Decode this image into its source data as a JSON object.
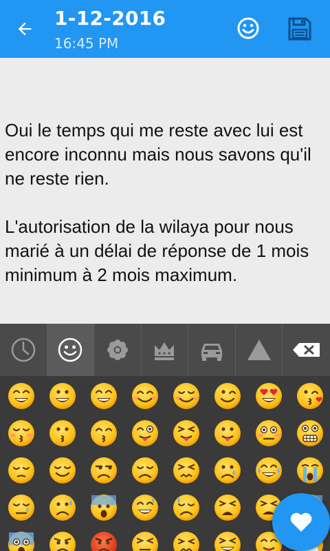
{
  "header": {
    "title": "1-12-2016",
    "subtitle": "16:45 PM",
    "back_icon": "arrow-back-icon",
    "emoji_icon": "smiley-icon",
    "save_icon": "floppy-disk-icon",
    "color": "#2196f3"
  },
  "note": {
    "paragraphs": [
      "Oui le temps qui me reste avec lui est encore inconnu mais nous savons qu'il ne reste rien.",
      "L'autorisation de la wilaya pour nous marié à un délai de réponse de 1 mois minimum à 2 mois maximum."
    ]
  },
  "keyboard": {
    "tabs": [
      {
        "icon": "clock-icon",
        "active": false
      },
      {
        "icon": "smiley-icon",
        "active": true
      },
      {
        "icon": "flower-icon",
        "active": false
      },
      {
        "icon": "crown-icon",
        "active": false
      },
      {
        "icon": "car-icon",
        "active": false
      },
      {
        "icon": "triangle-icon",
        "active": false
      },
      {
        "icon": "backspace-icon",
        "active": false
      }
    ],
    "emoji_rows": [
      [
        "grin",
        "smiley",
        "smile",
        "blush",
        "relaxed",
        "wink",
        "heart-eyes",
        "kissing-heart"
      ],
      [
        "kissing-closed-eyes",
        "kissing",
        "kissing-smiling-eyes",
        "stuck-out-tongue-winking-eye",
        "stuck-out-tongue-closed-eyes",
        "stuck-out-tongue",
        "flushed",
        "grimacing"
      ],
      [
        "pensive",
        "relieved",
        "unamused",
        "disappointed",
        "persevere",
        "cry",
        "joy",
        "sob"
      ],
      [
        "sleepy",
        "disappointed-relieved",
        "cold-sweat",
        "sweat-smile",
        "sweat",
        "weary",
        "tired-face",
        "fearful"
      ],
      [
        "scream",
        "angry",
        "rage",
        "triumph",
        "confounded",
        "laughing",
        "yum",
        "mask"
      ]
    ]
  },
  "fab": {
    "icon": "heart-icon",
    "color": "#2196f3"
  }
}
